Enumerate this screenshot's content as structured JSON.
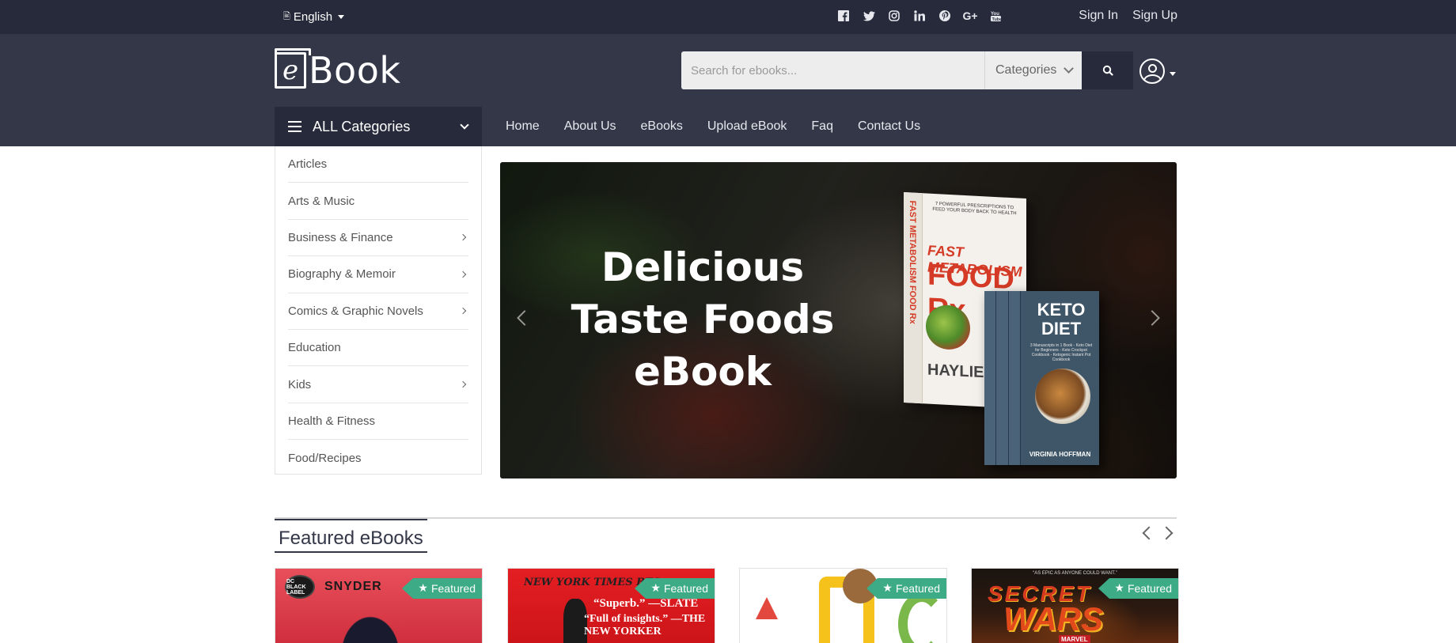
{
  "topbar": {
    "language": "English",
    "socials": [
      "facebook-icon",
      "twitter-icon",
      "instagram-icon",
      "linkedin-icon",
      "pinterest-icon",
      "google-plus-icon",
      "youtube-icon"
    ],
    "sign_in": "Sign In",
    "sign_up": "Sign Up"
  },
  "header": {
    "logo_mark": "e",
    "logo_text": "Book",
    "search_placeholder": "Search for ebooks...",
    "categories_label": "Categories"
  },
  "nav": {
    "all_categories": "ALL Categories",
    "links": [
      "Home",
      "About Us",
      "eBooks",
      "Upload eBook",
      "Faq",
      "Contact Us"
    ]
  },
  "sidebar": {
    "items": [
      {
        "label": "Articles",
        "has_sub": false
      },
      {
        "label": "Arts & Music",
        "has_sub": false
      },
      {
        "label": "Business & Finance",
        "has_sub": true
      },
      {
        "label": "Biography & Memoir",
        "has_sub": true
      },
      {
        "label": "Comics & Graphic Novels",
        "has_sub": true
      },
      {
        "label": "Education",
        "has_sub": false
      },
      {
        "label": "Kids",
        "has_sub": true
      },
      {
        "label": "Health & Fitness",
        "has_sub": false
      },
      {
        "label": "Food/Recipes",
        "has_sub": false
      }
    ]
  },
  "banner": {
    "title_line1": "Delicious",
    "title_line2": "Taste Foods",
    "title_line3": "eBook",
    "book1": {
      "subtitle": "7 POWERFUL PRESCRIPTIONS TO FEED YOUR BODY BACK TO HEALTH",
      "spine": "FAST METABOLISM FOOD Rx",
      "fast": "FAST METABOLISM",
      "food": "FOOD Rx",
      "author": "HAYLIE"
    },
    "book2": {
      "title_line1": "KETO",
      "title_line2": "DIET",
      "desc": "3 Manuscripts in 1 Book - Keto Diet for Beginners - Keto Crockpot Cookbook - Ketogenic Instant Pot Cookbook",
      "author": "VIRGINIA HOFFMAN"
    }
  },
  "featured": {
    "title": "Featured eBooks",
    "badge": "Featured",
    "cards": [
      {
        "name": "snyder-batman",
        "text1": "SNYDER",
        "text2": "DC BLACK LABEL"
      },
      {
        "name": "nyt-bestseller",
        "text1": "NEW YORK TIMES BES",
        "text2": "“Superb.” —SLATE",
        "text3": "“Full of insights.” —THE NEW YORKER"
      },
      {
        "name": "abc-kids",
        "text1": ""
      },
      {
        "name": "secret-wars",
        "text1": "“AS EPIC AS ANYONE COULD WANT.”",
        "text2": "SECRET",
        "text3": "WARS",
        "text4": "MARVEL"
      }
    ]
  },
  "colors": {
    "topbar": "#262a3a",
    "header": "#333748",
    "badge": "#3dab86"
  }
}
